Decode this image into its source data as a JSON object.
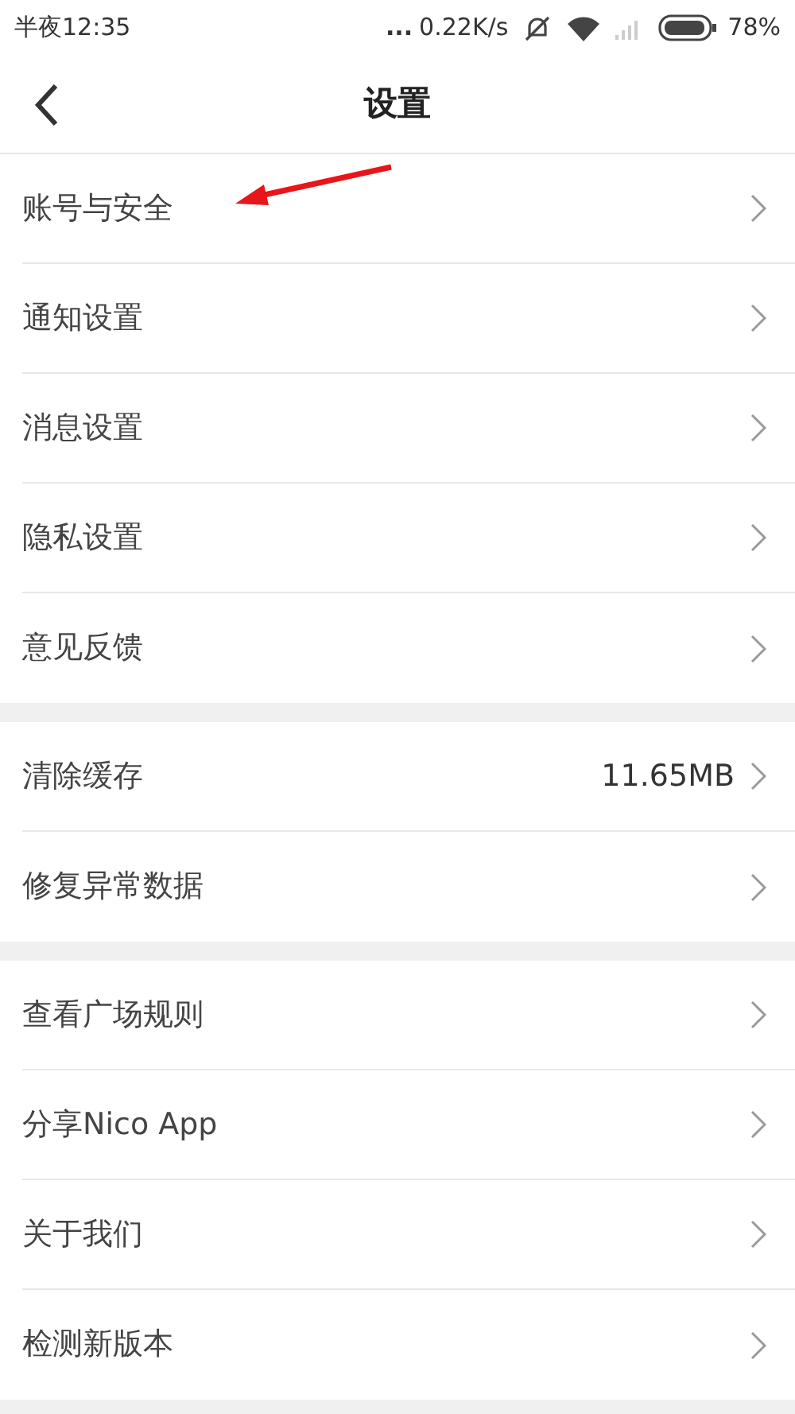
{
  "status_bar": {
    "time": "半夜12:35",
    "dots": "...",
    "network_speed": "0.22K/s",
    "battery": "78%"
  },
  "header": {
    "title": "设置"
  },
  "groups": [
    {
      "items": [
        {
          "label": "账号与安全"
        },
        {
          "label": "通知设置"
        },
        {
          "label": "消息设置"
        },
        {
          "label": "隐私设置"
        },
        {
          "label": "意见反馈"
        }
      ]
    },
    {
      "items": [
        {
          "label": "清除缓存",
          "value": "11.65MB"
        },
        {
          "label": "修复异常数据"
        }
      ]
    },
    {
      "items": [
        {
          "label": "查看广场规则"
        },
        {
          "label": "分享Nico App"
        },
        {
          "label": "关于我们"
        },
        {
          "label": "检测新版本"
        }
      ]
    }
  ]
}
